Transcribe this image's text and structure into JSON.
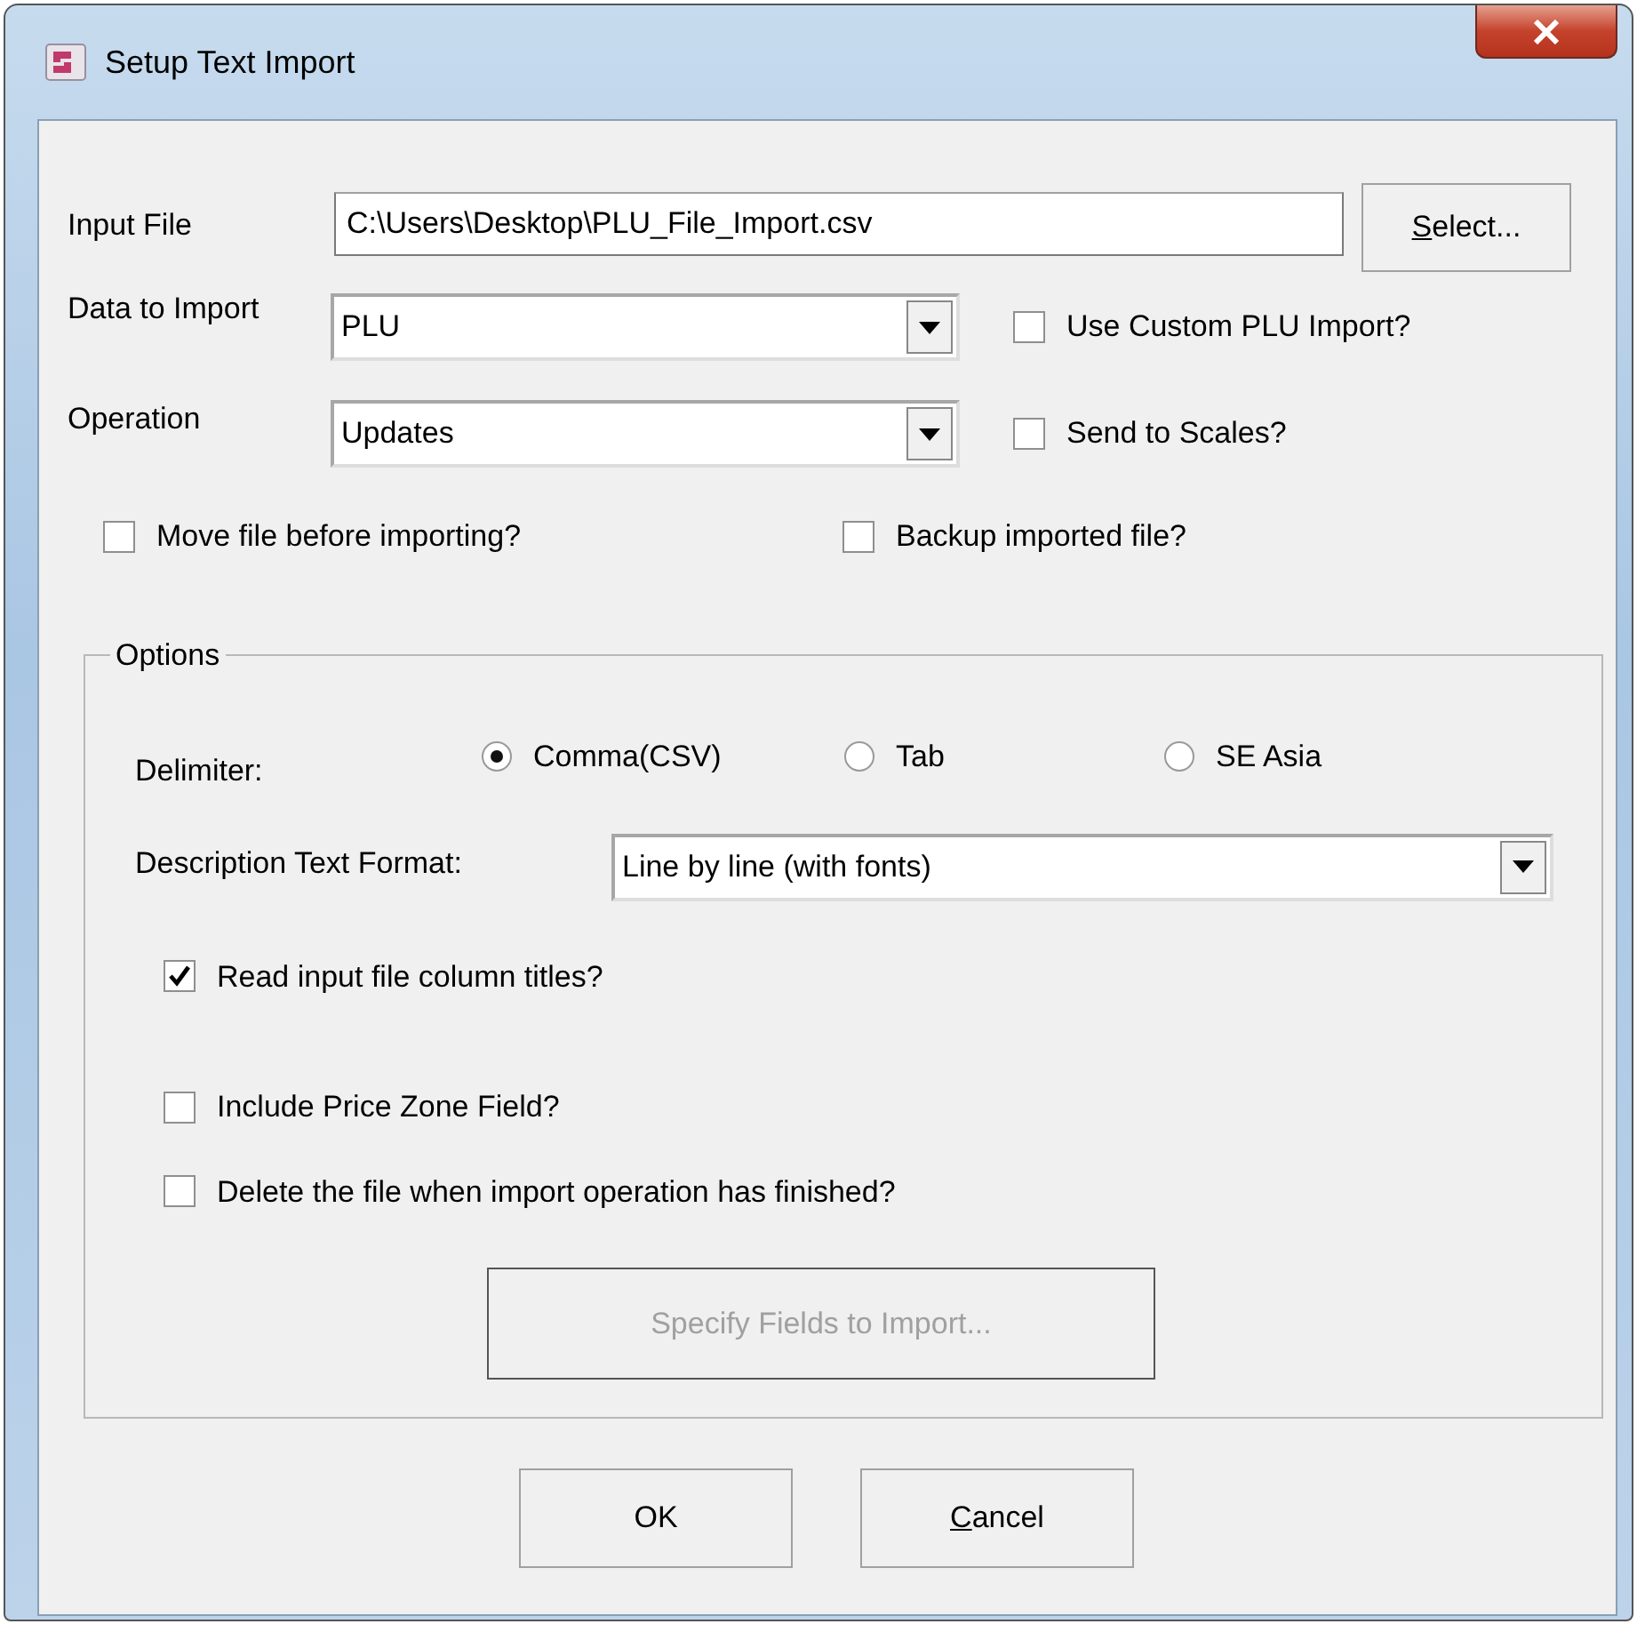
{
  "window": {
    "title": "Setup Text Import"
  },
  "input_file": {
    "label": "Input File",
    "value": "C:\\Users\\Desktop\\PLU_File_Import.csv",
    "button": {
      "label": "Select...",
      "underline_first": true,
      "disabled": false
    }
  },
  "data_to_import": {
    "label": "Data to Import",
    "value": "PLU",
    "option": {
      "label": "Use Custom PLU Import?",
      "checked": false
    }
  },
  "operation": {
    "label": "Operation",
    "value": "Updates",
    "option": {
      "label": "Send to Scales?",
      "checked": false
    }
  },
  "file_options": [
    {
      "label": "Move file before importing?",
      "checked": false
    },
    {
      "label": "Backup imported file?",
      "checked": false
    }
  ],
  "options": {
    "title": "Options",
    "delimiter": {
      "label": "Delimiter:",
      "choices": [
        {
          "label": "Comma(CSV)",
          "selected": true
        },
        {
          "label": "Tab",
          "selected": false
        },
        {
          "label": "SE Asia",
          "selected": false
        }
      ]
    },
    "description_format": {
      "label": "Description Text Format:",
      "value": "Line by line (with fonts)"
    },
    "checks": [
      {
        "label": "Read input file column titles?",
        "checked": true
      },
      {
        "label": "Include Price Zone Field?",
        "checked": false
      },
      {
        "label": "Delete the file when import operation has finished?",
        "checked": false
      }
    ],
    "fields_button": {
      "label": "Specify Fields to Import...",
      "underline_first": false,
      "disabled": true
    }
  },
  "buttons": [
    {
      "label": "OK",
      "underline_first": false,
      "disabled": false
    },
    {
      "label": "Cancel",
      "underline_first": true,
      "disabled": false
    }
  ]
}
